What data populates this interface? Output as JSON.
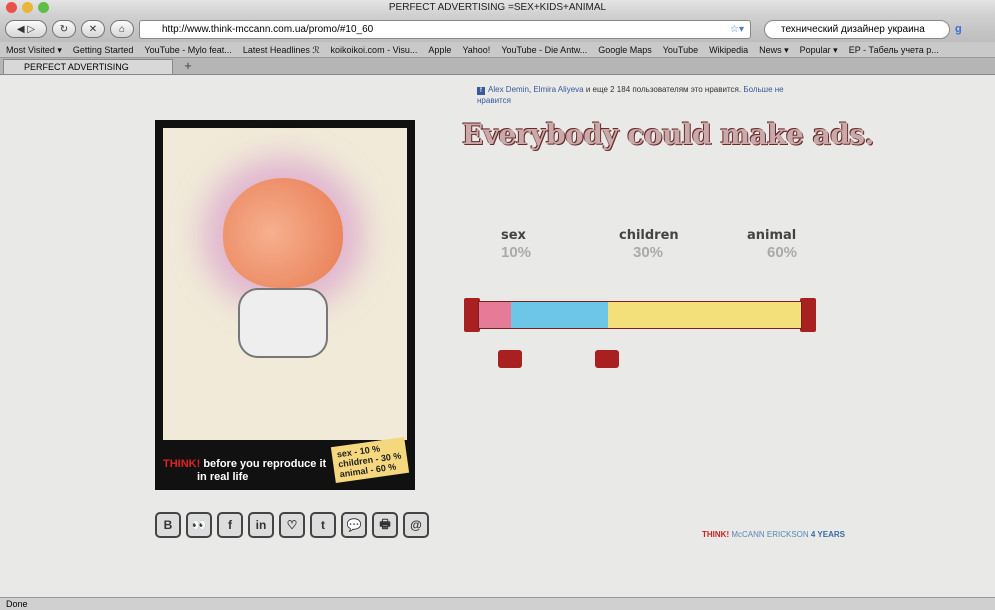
{
  "window": {
    "title": "PERFECT ADVERTISING =SEX+KIDS+ANIMAL"
  },
  "toolbar": {
    "url": "http://www.think-mccann.com.ua/promo/#10_60",
    "search": "технический дизайнер украина"
  },
  "bookmarks": [
    "Most Visited ▾",
    "Getting Started",
    "YouTube - Mylo feat...",
    "Latest Headlines ℛ",
    "koikoikoi.com - Visu...",
    "Apple",
    "Yahoo!",
    "YouTube - Die Antw...",
    "Google Maps",
    "YouTube",
    "Wikipedia",
    "News ▾",
    "Popular ▾",
    "EP - Табель учета р..."
  ],
  "tab": {
    "label": "PERFECT ADVERTISING =SEX+KID...",
    "new": "+"
  },
  "status": "Done",
  "facebook": {
    "name1": "Alex Demin",
    "sep": ", ",
    "name2": "Elmira Aliyeva",
    "text": " и еще 2 184 пользователям это нравится. ",
    "link": "Больше не нравится"
  },
  "headline": "Everybody could make ads.",
  "poster": {
    "think": "THINK!",
    "line1": " before you reproduce it",
    "line2": "in real life",
    "note": [
      "sex - 10 %",
      "children - 30 %",
      "animal - 60 %"
    ]
  },
  "slider": {
    "items": [
      {
        "label": "sex",
        "percent": "10%",
        "value": 10,
        "color": "#e67b98"
      },
      {
        "label": "children",
        "percent": "30%",
        "value": 30,
        "color": "#6ec6e6"
      },
      {
        "label": "animal",
        "percent": "60%",
        "value": 60,
        "color": "#f3e07a"
      }
    ]
  },
  "socials": [
    "B",
    "👀",
    "f",
    "in",
    "♡",
    "t",
    "💬",
    "🖶",
    "@"
  ],
  "footer": {
    "think": "THINK!",
    "agency": " McCANN ERICKSON",
    "years": "  4 YEARS"
  }
}
